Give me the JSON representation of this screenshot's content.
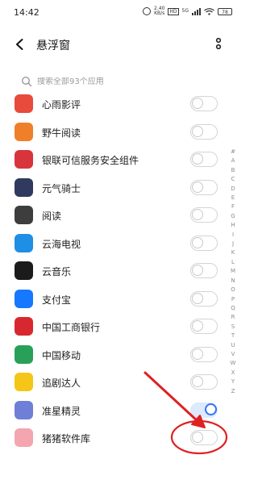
{
  "status_bar": {
    "time": "14:42",
    "speed_value": "2.40",
    "speed_unit": "KB/s",
    "hd": "HD",
    "network": "5G",
    "battery": "78"
  },
  "header": {
    "title": "悬浮窗"
  },
  "search": {
    "placeholder": "搜索全部93个应用"
  },
  "apps": [
    {
      "name": "心雨影评",
      "enabled": false,
      "icon": "xinyu-app-icon",
      "color": "#e84a3c"
    },
    {
      "name": "野牛阅读",
      "enabled": false,
      "icon": "yeniu-app-icon",
      "color": "#f07f2a"
    },
    {
      "name": "银联可信服务安全组件",
      "enabled": false,
      "icon": "unionpay-app-icon",
      "color": "#d8343c"
    },
    {
      "name": "元气骑士",
      "enabled": false,
      "icon": "soul-knight-app-icon",
      "color": "#2f3a5e"
    },
    {
      "name": "阅读",
      "enabled": false,
      "icon": "reading-app-icon",
      "color": "#3d3d3d"
    },
    {
      "name": "云海电视",
      "enabled": false,
      "icon": "yunhai-tv-app-icon",
      "color": "#1f8fe6"
    },
    {
      "name": "云音乐",
      "enabled": false,
      "icon": "cloud-music-app-icon",
      "color": "#1b1b1b"
    },
    {
      "name": "支付宝",
      "enabled": false,
      "icon": "alipay-app-icon",
      "color": "#1677ff"
    },
    {
      "name": "中国工商银行",
      "enabled": false,
      "icon": "icbc-app-icon",
      "color": "#d8282f"
    },
    {
      "name": "中国移动",
      "enabled": false,
      "icon": "china-mobile-app-icon",
      "color": "#29a05a"
    },
    {
      "name": "追剧达人",
      "enabled": false,
      "icon": "zhuiju-app-icon",
      "color": "#f5c518"
    },
    {
      "name": "准星精灵",
      "enabled": true,
      "icon": "crosshair-app-icon",
      "color": "#6f7fd8"
    },
    {
      "name": "猪猪软件库",
      "enabled": false,
      "icon": "pig-app-icon",
      "color": "#f4a6b0"
    }
  ],
  "alphabet": [
    "#",
    "A",
    "B",
    "C",
    "D",
    "E",
    "F",
    "G",
    "H",
    "I",
    "J",
    "K",
    "L",
    "M",
    "N",
    "O",
    "P",
    "Q",
    "R",
    "S",
    "T",
    "U",
    "V",
    "W",
    "X",
    "Y",
    "Z"
  ],
  "colors": {
    "accent": "#3274f6",
    "annotation": "#e02020"
  }
}
